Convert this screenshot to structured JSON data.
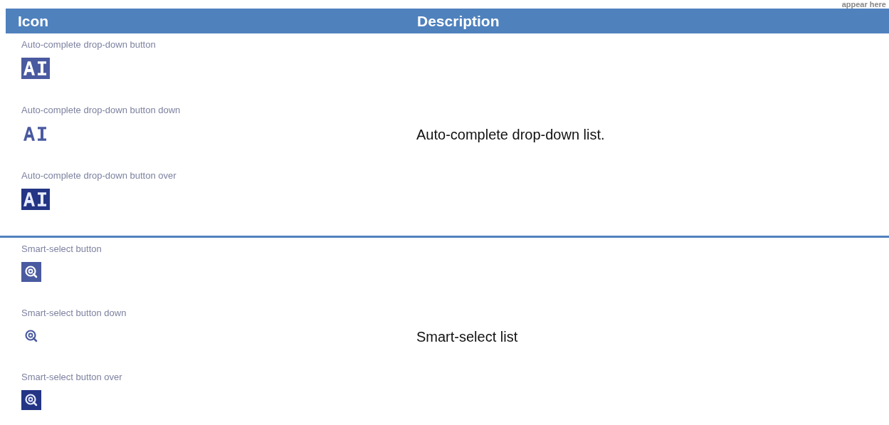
{
  "top_note": "appear here",
  "table": {
    "columns": [
      "Icon",
      "Description"
    ],
    "rows": [
      {
        "icons": [
          {
            "label": "Auto-complete drop-down button",
            "kind": "ai",
            "pressed": false,
            "hovered": false
          },
          {
            "label": "Auto-complete drop-down button down",
            "kind": "ai",
            "pressed": true,
            "hovered": false
          },
          {
            "label": "Auto-complete drop-down button over",
            "kind": "ai",
            "pressed": false,
            "hovered": true
          }
        ],
        "description": "Auto-complete drop-down list."
      },
      {
        "icons": [
          {
            "label": "Smart-select button",
            "kind": "smart-select",
            "pressed": false,
            "hovered": false
          },
          {
            "label": "Smart-select button down",
            "kind": "smart-select",
            "pressed": true,
            "hovered": false
          },
          {
            "label": "Smart-select button over",
            "kind": "smart-select",
            "pressed": false,
            "hovered": true
          }
        ],
        "description": "Smart-select list"
      }
    ]
  }
}
